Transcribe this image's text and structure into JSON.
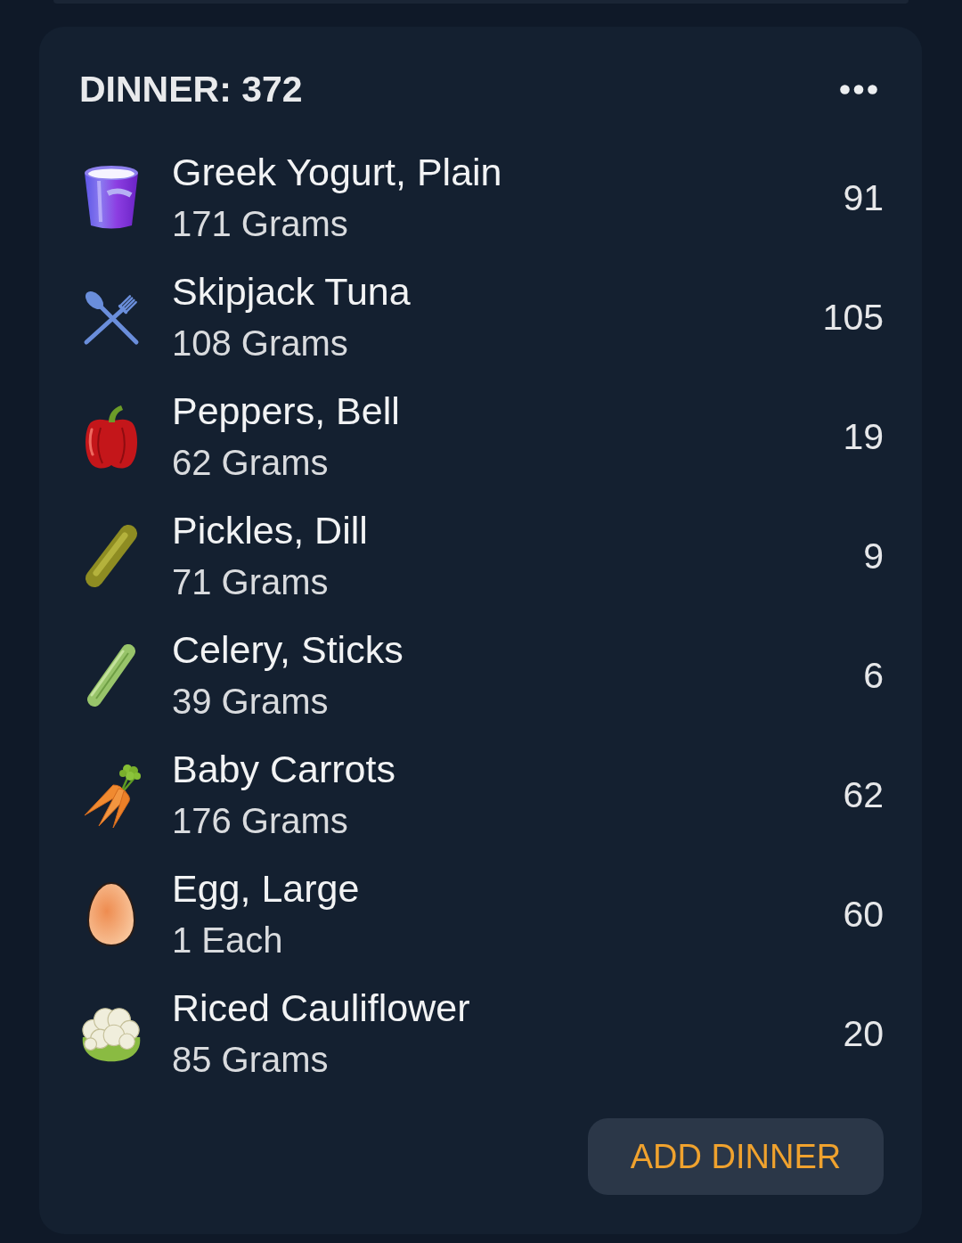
{
  "meal": {
    "title": "DINNER: 372"
  },
  "foods": [
    {
      "kind": "yogurt",
      "name": "Greek Yogurt, Plain",
      "amount": "171 Grams",
      "calories": "91"
    },
    {
      "kind": "utensils",
      "name": "Skipjack Tuna",
      "amount": "108 Grams",
      "calories": "105"
    },
    {
      "kind": "pepper",
      "name": "Peppers, Bell",
      "amount": "62 Grams",
      "calories": "19"
    },
    {
      "kind": "pickle",
      "name": "Pickles, Dill",
      "amount": "71 Grams",
      "calories": "9"
    },
    {
      "kind": "celery",
      "name": "Celery, Sticks",
      "amount": "39 Grams",
      "calories": "6"
    },
    {
      "kind": "carrot",
      "name": "Baby Carrots",
      "amount": "176 Grams",
      "calories": "62"
    },
    {
      "kind": "egg",
      "name": "Egg, Large",
      "amount": "1 Each",
      "calories": "60"
    },
    {
      "kind": "cauliflower",
      "name": "Riced Cauliflower",
      "amount": "85 Grams",
      "calories": "20"
    }
  ],
  "add_button": {
    "label": "ADD DINNER"
  }
}
